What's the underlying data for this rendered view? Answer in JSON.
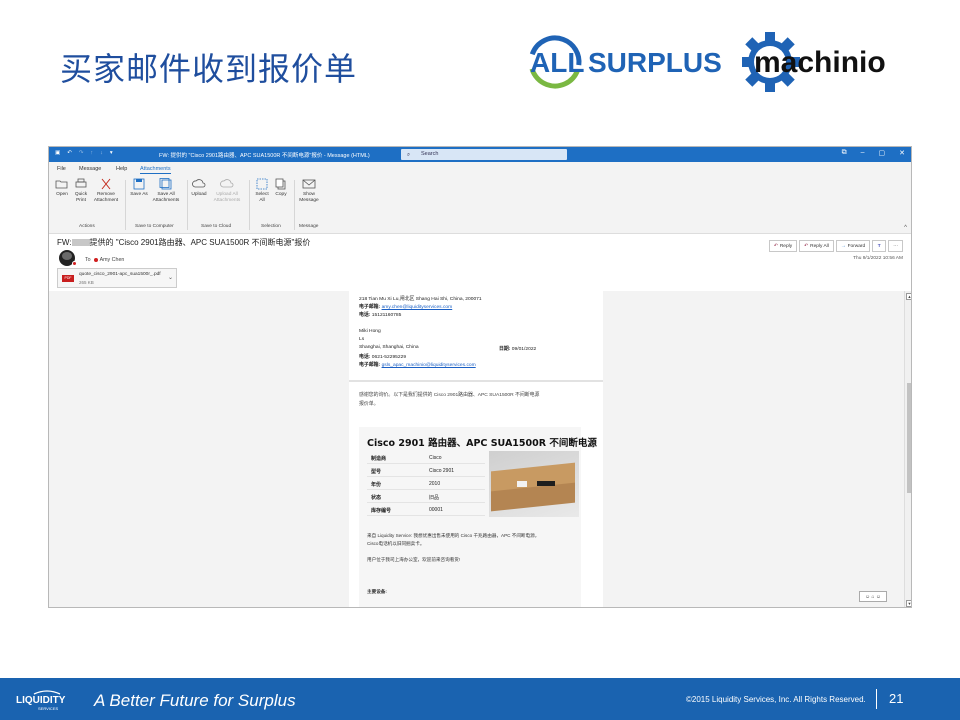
{
  "slide": {
    "title": "买家邮件收到报价单",
    "logo_allsurplus": {
      "part1": "ALL",
      "part2": "SURPLUS"
    },
    "logo_machinio": "machinio"
  },
  "window": {
    "title": "FW: 提供的 \"Cisco 2901路由器、APC SUA1500R 不间断电源\"报价 - Message (HTML)",
    "search_placeholder": "Search",
    "controls": {
      "restore": "⧉",
      "minimize": "–",
      "maximize": "▢",
      "close": "✕"
    }
  },
  "menu": {
    "file": "File",
    "message": "Message",
    "help": "Help",
    "attachments": "Attachments"
  },
  "ribbon": {
    "open": "Open",
    "quick_print": "Quick Print",
    "remove_attachment": "Remove Attachment",
    "save_as": "Save As",
    "save_all": "Save All Attachments",
    "upload": "Upload",
    "upload_all": "Upload All Attachments",
    "select_all": "Select All",
    "copy": "Copy",
    "show_message": "Show Message",
    "group_actions": "Actions",
    "group_save_computer": "Save to Computer",
    "group_save_cloud": "Save to Cloud",
    "group_selection": "Selection",
    "group_message": "Message"
  },
  "email": {
    "subject_prefix": "FW:",
    "subject_rest": "提供的 \"Cisco 2901路由器、APC SUA1500R 不间断电源\"报价",
    "to_label": "To",
    "recipient": "Amy Chen",
    "attachment_name": "quote_cisco_2901-apc_sua1500r_.pdf",
    "attachment_size": "265 KB",
    "pdf_label": "PDF",
    "reply": "Reply",
    "reply_all": "Reply All",
    "forward": "Forward",
    "more": "···",
    "date": "Thu 9/1/2022 10:56 AM"
  },
  "doc": {
    "addr1": "218 Tian Mu Xi Lu,闸北区 Shang Hai Shi, China, 200071",
    "email_label": "电子邮箱:",
    "email1": "amy.chen@liquidityservices.com",
    "phone_label": "电话:",
    "phone1": "15121160785",
    "name2": "Miki Hong",
    "line_ls": "Ls",
    "city2": "Shanghai, Shanghai, China",
    "date_label": "日期:",
    "date2": "09/01/2022",
    "phone2": "0621-52295229",
    "email2": "gsls_apac_machinio@liquidityservices.com",
    "thanks1": "感谢您的询价。以下是我们提供的 Cisco 2901路由器、APC SUA1500R 不间断电源",
    "thanks2": "报价单。",
    "card_title": "Cisco 2901 路由器、APC SUA1500R 不间断电源",
    "specs": [
      {
        "k": "制造商",
        "v": "Cisco"
      },
      {
        "k": "型号",
        "v": "Cisco 2901"
      },
      {
        "k": "年份",
        "v": "2010"
      },
      {
        "k": "状态",
        "v": "旧品"
      },
      {
        "k": "库存编号",
        "v": "00001"
      }
    ],
    "para1": "来自 Liquidity Service: 我想优惠出售未使用的 Cisco 千兆路由器，APC 不间断电源，",
    "para2": "Cisco电话机以旧同捆卖卡。",
    "para3": "用户位于我司上海办公室，欢迎前来咨询看货!",
    "main_equip": "主要设备:"
  },
  "footer": {
    "logo": "LIQUIDITY",
    "logo_sub": "SERVICES",
    "tagline": "A Better Future for Surplus",
    "copyright": "©2015 Liquidity Services, Inc. All Rights Reserved.",
    "page": "21"
  }
}
